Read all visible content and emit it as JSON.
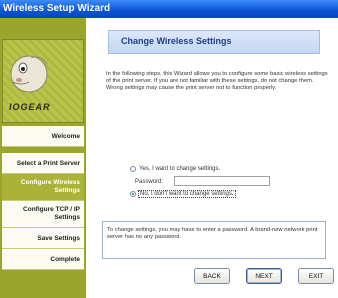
{
  "window": {
    "title": "Wireless Setup Wizard"
  },
  "brand": {
    "logo_text": "IOGEAR"
  },
  "steps": [
    {
      "label": "Welcome"
    },
    {
      "label": "Select a Print Server"
    },
    {
      "label": "Configure Wireless Settings",
      "state": "active"
    },
    {
      "label": "Configure TCP / IP Settings"
    },
    {
      "label": "Save Settings"
    },
    {
      "label": "Complete"
    }
  ],
  "page": {
    "heading": "Change Wireless Settings",
    "intro": "In the following steps, this Wizard allows you to configure some basic wireless settings of the print server. If you are not familiar with these settings, do not change them. Wrong settings may cause the print server not to function properly.",
    "options": {
      "yes_label": "Yes, I want to change settings.",
      "password_label": "Password:",
      "password_value": "",
      "no_label": "No, I don't want to change settings.",
      "selected": "no"
    },
    "note": "To change settings, you may have to enter a password. A brand-new network print server has no any password."
  },
  "buttons": {
    "back": "BACK",
    "next": "NEXT",
    "exit": "EXIT"
  }
}
